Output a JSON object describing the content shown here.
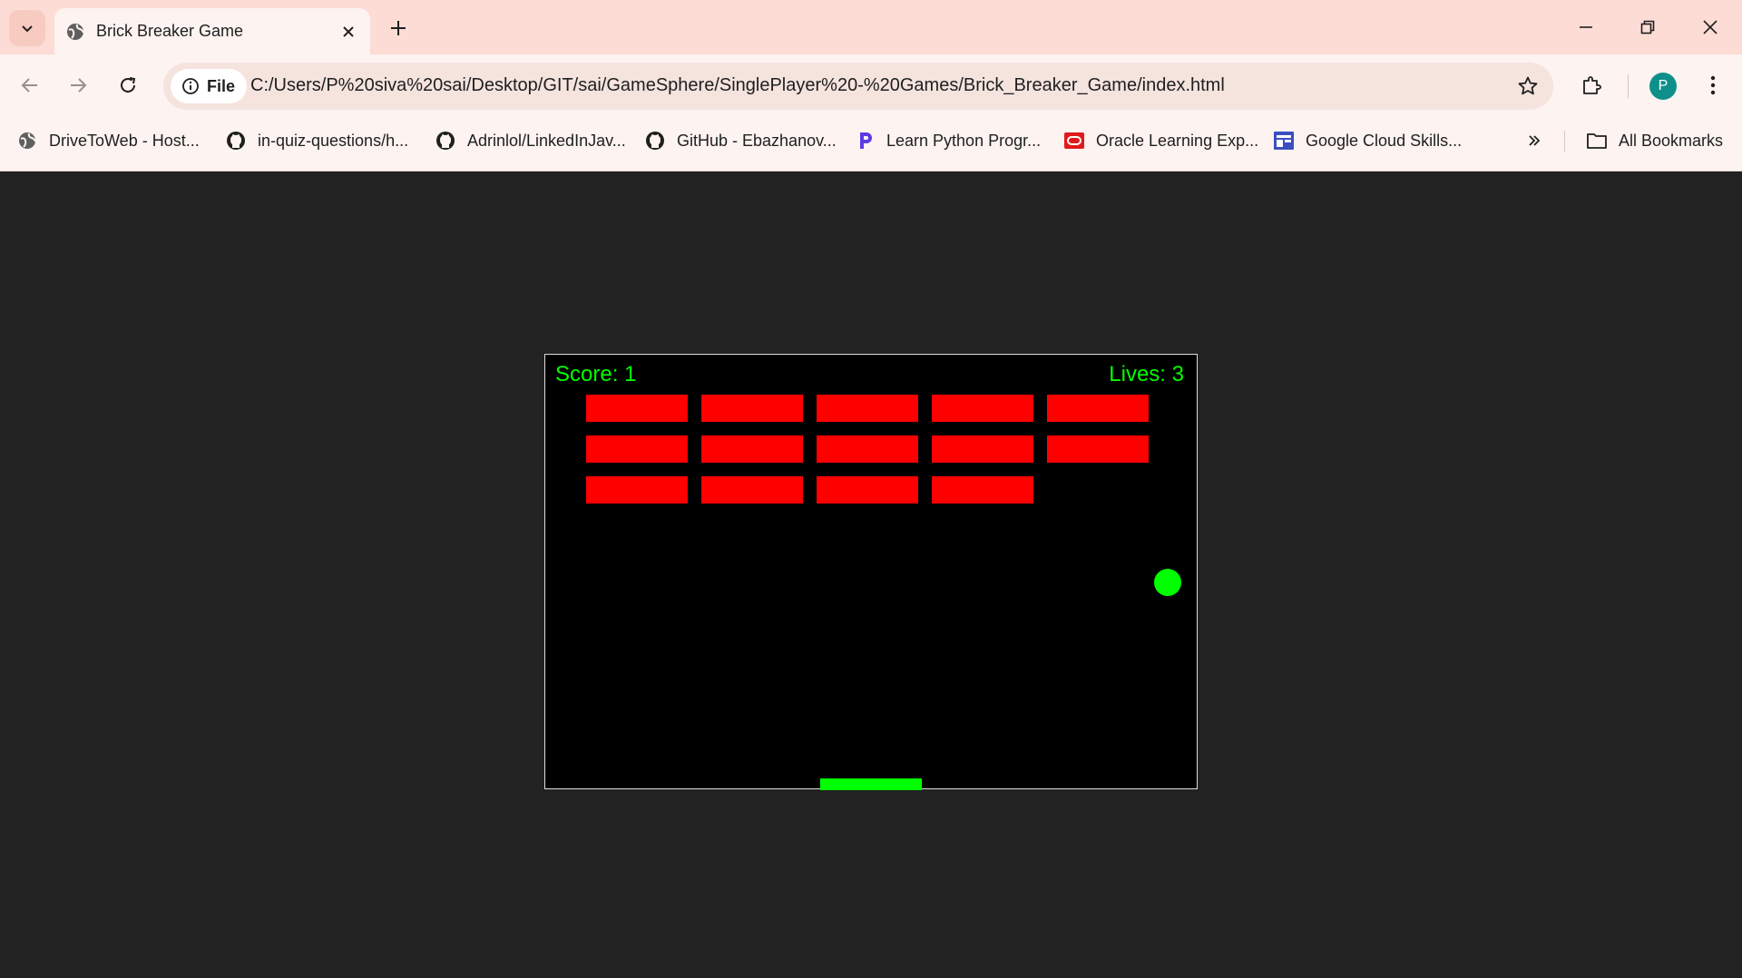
{
  "browser": {
    "tab": {
      "title": "Brick Breaker Game"
    },
    "omnibox": {
      "chip_label": "File",
      "url": "C:/Users/P%20siva%20sai/Desktop/GIT/sai/GameSphere/SinglePlayer%20-%20Games/Brick_Breaker_Game/index.html"
    },
    "profile_initial": "P",
    "bookmarks": [
      {
        "label": "DriveToWeb - Host...",
        "icon": "globe-icon"
      },
      {
        "label": "in-quiz-questions/h...",
        "icon": "github-icon"
      },
      {
        "label": "Adrinlol/LinkedInJav...",
        "icon": "github-icon"
      },
      {
        "label": "GitHub - Ebazhanov...",
        "icon": "github-icon"
      },
      {
        "label": "Learn Python Progr...",
        "icon": "programiz-icon"
      },
      {
        "label": "Oracle Learning Exp...",
        "icon": "oracle-icon"
      },
      {
        "label": "Google Cloud Skills...",
        "icon": "google-cloud-skills-icon"
      }
    ],
    "all_bookmarks_label": "All Bookmarks"
  },
  "game": {
    "score_text": "Score: 1",
    "lives_text": "Lives: 3",
    "colors": {
      "background": "#000000",
      "brick": "#ff0000",
      "ball": "#00ff00",
      "paddle": "#00ff00",
      "text": "#00ff00"
    },
    "bricks": [
      [
        true,
        true,
        true,
        true,
        true
      ],
      [
        true,
        true,
        true,
        true,
        true
      ],
      [
        true,
        true,
        true,
        true,
        false
      ]
    ]
  }
}
